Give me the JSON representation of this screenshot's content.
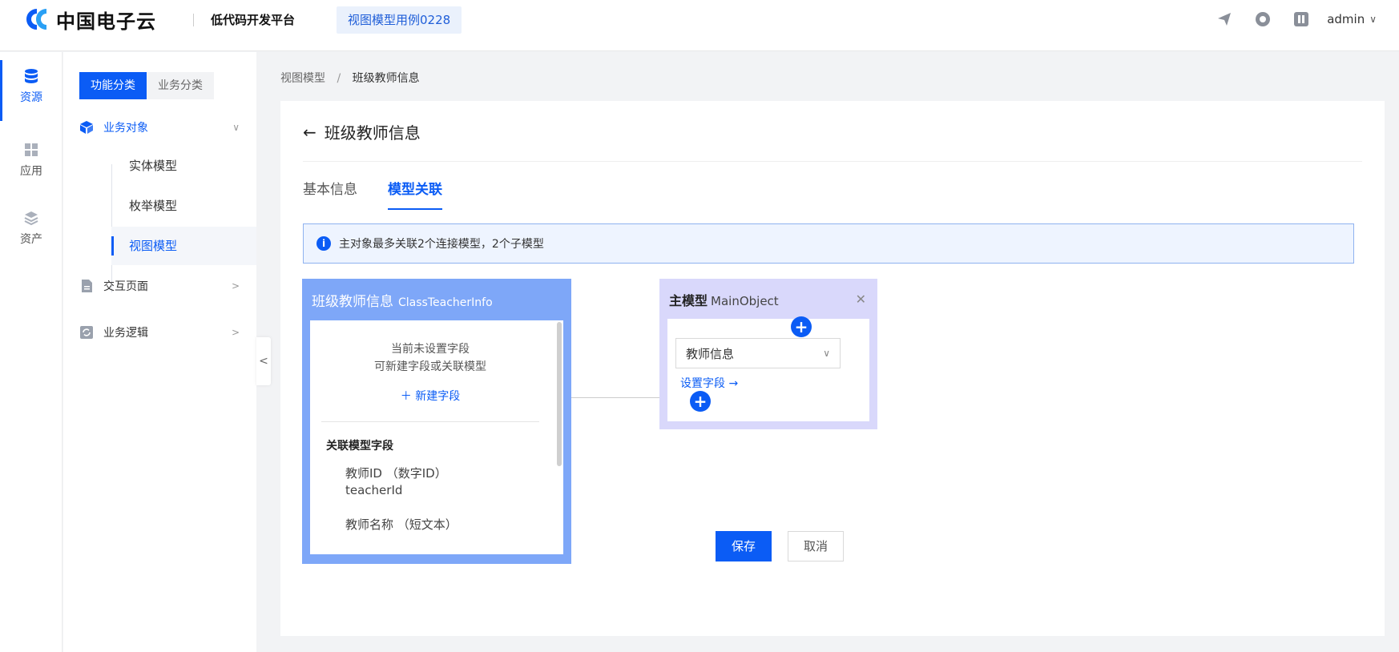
{
  "header": {
    "brand_name": "中国电子云",
    "platform_name": "低代码开发平台",
    "app_tag": "视图模型用例0228",
    "user_name": "admin",
    "accent_color": "#0b5cf5"
  },
  "rail": {
    "items": [
      {
        "label": "资源",
        "icon": "database-icon",
        "active": true
      },
      {
        "label": "应用",
        "icon": "grid-icon",
        "active": false
      },
      {
        "label": "资产",
        "icon": "layers-icon",
        "active": false
      }
    ]
  },
  "sidebar": {
    "segments": [
      "功能分类",
      "业务分类"
    ],
    "groups": [
      {
        "label": "业务对象",
        "icon": "cube-icon",
        "expanded": true
      },
      {
        "label": "交互页面",
        "icon": "page-icon",
        "expanded": false
      },
      {
        "label": "业务逻辑",
        "icon": "logic-icon",
        "expanded": false
      }
    ],
    "sub_items": [
      "实体模型",
      "枚举模型",
      "视图模型"
    ]
  },
  "breadcrumb": {
    "root": "视图模型",
    "separator": "/",
    "current": "班级教师信息"
  },
  "page": {
    "title": "班级教师信息",
    "tabs": [
      "基本信息",
      "模型关联"
    ],
    "active_tab": "模型关联",
    "notice": "主对象最多关联2个连接模型，2个子模型"
  },
  "view_model": {
    "name": "班级教师信息",
    "code": "ClassTeacherInfo",
    "empty_line_1": "当前未设置字段",
    "empty_line_2": "可新建字段或关联模型",
    "new_field": "＋ 新建字段",
    "assoc_title": "关联模型字段",
    "fields": [
      {
        "name": "教师ID （数字ID）",
        "code": "teacherId"
      },
      {
        "name": "教师名称 （短文本）",
        "code": ""
      }
    ]
  },
  "main_model": {
    "label": "主模型",
    "code": "MainObject",
    "selected": "教师信息",
    "set_field": "设置字段 →"
  },
  "actions": {
    "save": "保存",
    "cancel": "取消"
  }
}
